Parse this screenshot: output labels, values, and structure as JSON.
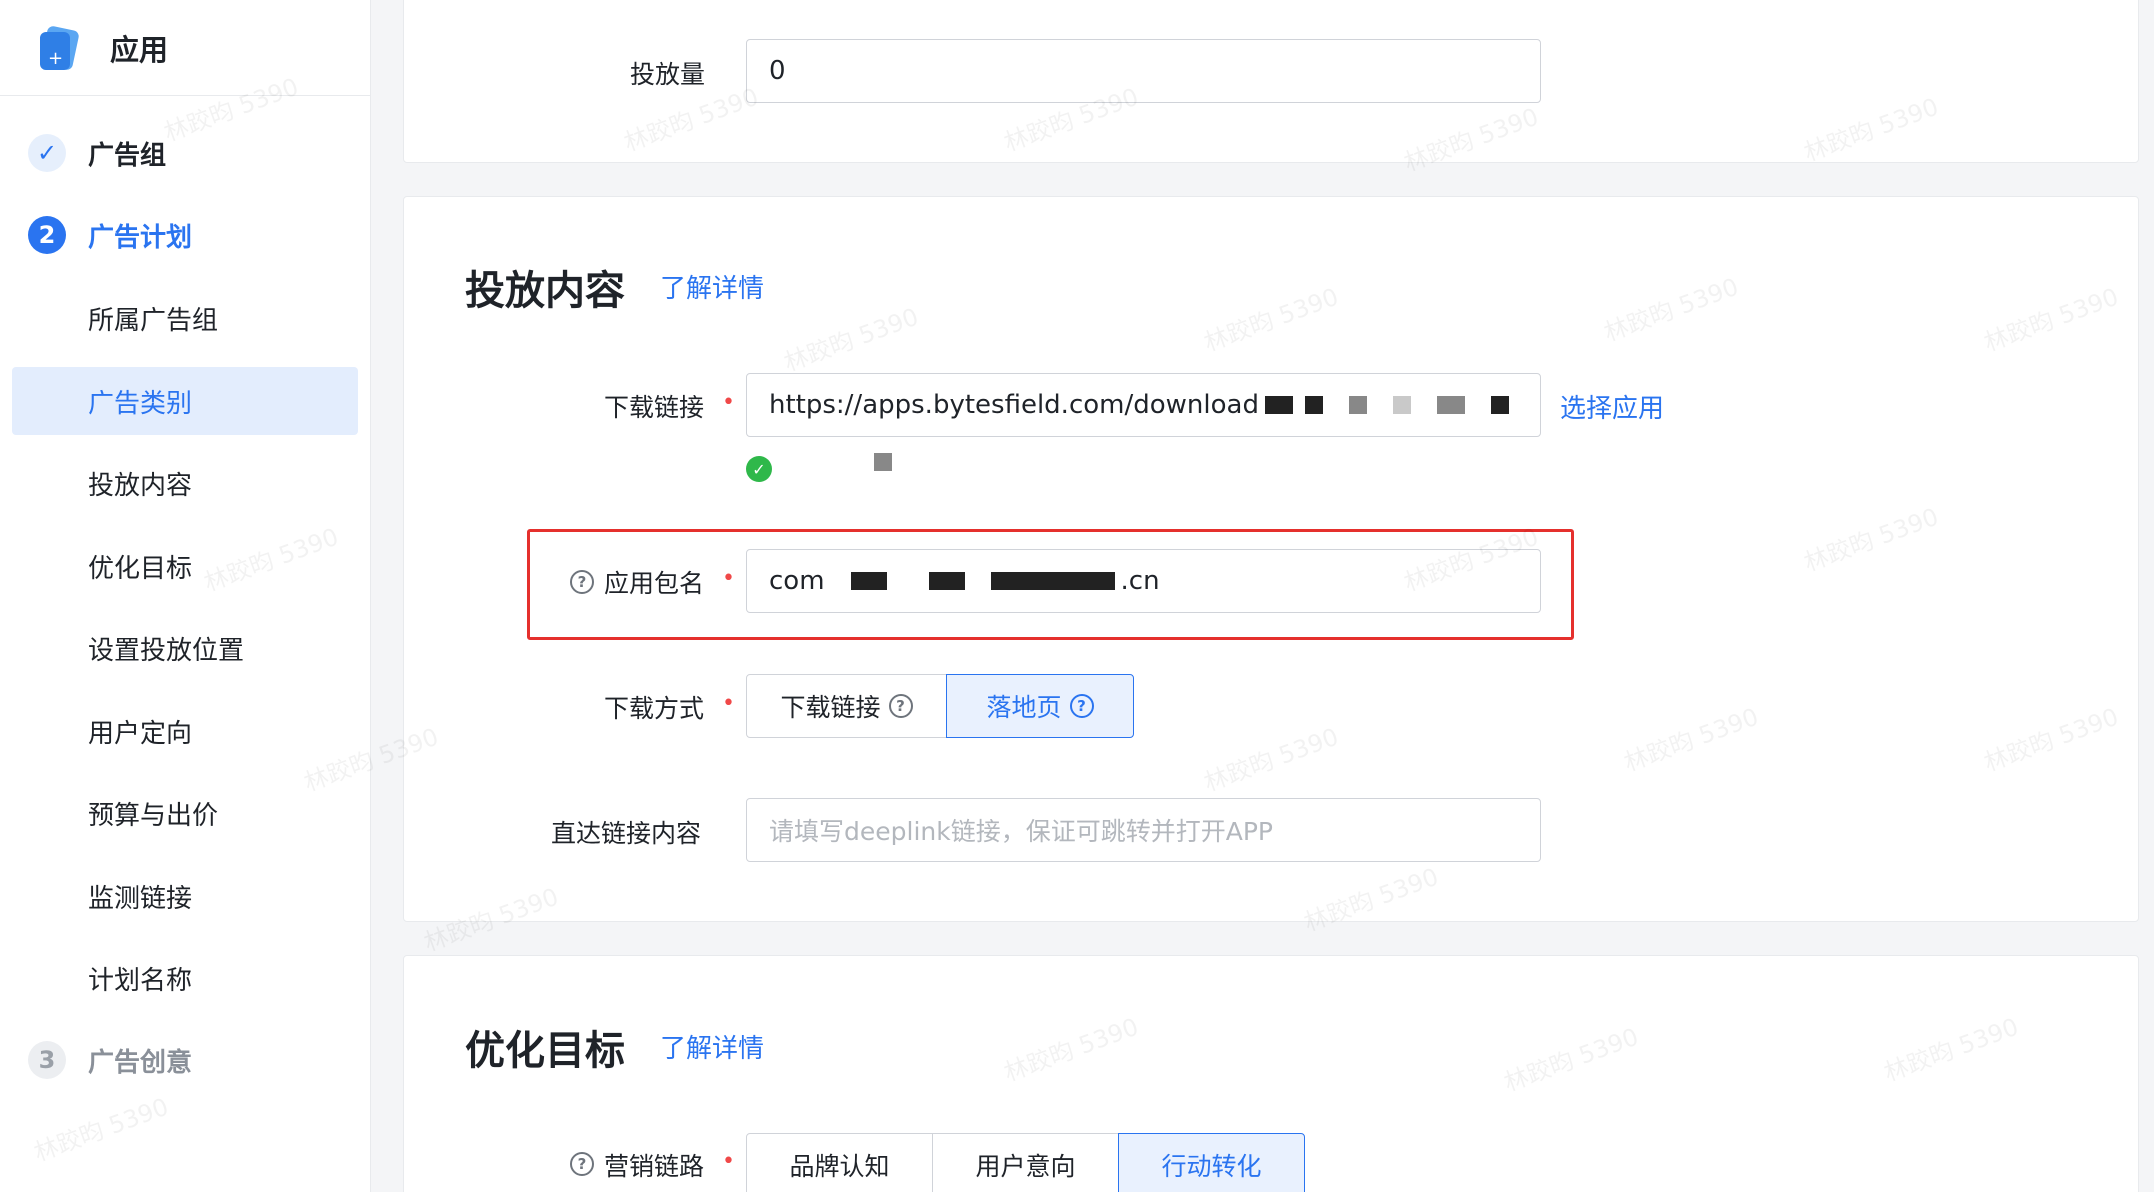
{
  "app": {
    "title": "应用"
  },
  "sidebar": {
    "steps": [
      {
        "number": "✓",
        "label": "广告组",
        "state": "done"
      },
      {
        "number": "2",
        "label": "广告计划",
        "state": "active"
      },
      {
        "number": "3",
        "label": "广告创意",
        "state": "todo"
      }
    ],
    "sub_items": [
      "所属广告组",
      "广告类别",
      "投放内容",
      "优化目标",
      "设置投放位置",
      "用户定向",
      "预算与出价",
      "监测链接",
      "计划名称"
    ],
    "selected_sub_item": "广告类别"
  },
  "form": {
    "volume": {
      "label": "投放量",
      "value": "0"
    },
    "content_section": {
      "title": "投放内容",
      "details_link": "了解详情",
      "download_link": {
        "label": "下载链接",
        "value": "https://apps.bytesfield.com/download",
        "action": "选择应用"
      },
      "package_name": {
        "label": "应用包名",
        "value_prefix": "com",
        "value_suffix": ".cn"
      },
      "download_method": {
        "label": "下载方式",
        "options": [
          "下载链接",
          "落地页"
        ],
        "selected": "落地页"
      },
      "deeplink": {
        "label": "直达链接内容",
        "placeholder": "请填写deeplink链接，保证可跳转并打开APP"
      }
    },
    "optimization_section": {
      "title": "优化目标",
      "details_link": "了解详情",
      "marketing_chain": {
        "label": "营销链路",
        "options": [
          "品牌认知",
          "用户意向",
          "行动转化"
        ],
        "selected": "行动转化"
      }
    }
  },
  "colors": {
    "accent": "#2a74f0",
    "required": "#f04848",
    "highlight_border": "#e5302d",
    "success": "#2fb84a"
  },
  "watermark_text": "林跤昀 5390"
}
